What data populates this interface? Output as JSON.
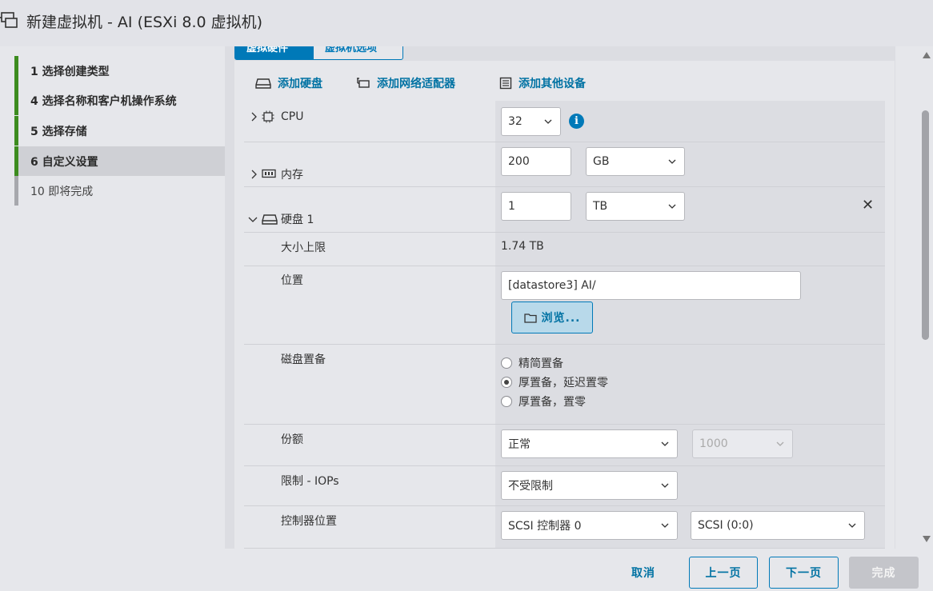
{
  "window": {
    "title": "新建虚拟机 - AI (ESXi 8.0 虚拟机)"
  },
  "steps": [
    {
      "label": "1   选择创建类型",
      "state": "done"
    },
    {
      "label": "4   选择名称和客户机操作系统",
      "state": "done"
    },
    {
      "label": "5   选择存储",
      "state": "done"
    },
    {
      "label": "6   自定义设置",
      "state": "active"
    },
    {
      "label": "10   即将完成",
      "state": "pending"
    }
  ],
  "tabs": {
    "hardware": "虚拟硬件",
    "options": "虚拟机选项"
  },
  "toolbar": {
    "add_disk": "添加硬盘",
    "add_network": "添加网络适配器",
    "add_other": "添加其他设备"
  },
  "cpu": {
    "label": "CPU",
    "value": "32"
  },
  "memory": {
    "label": "内存",
    "value": "200",
    "unit": "GB"
  },
  "disk": {
    "label": "硬盘 1",
    "value": "1",
    "unit": "TB",
    "max_size_label": "大小上限",
    "max_size_value": "1.74 TB",
    "location_label": "位置",
    "location_value": "[datastore3] AI/",
    "browse_label": "浏览...",
    "provisioning_label": "磁盘置备",
    "provisioning_options": [
      "精简置备",
      "厚置备，延迟置零",
      "厚置备，置零"
    ],
    "provisioning_selected": 1,
    "shares_label": "份额",
    "shares_value": "正常",
    "shares_number": "1000",
    "limit_label": "限制 - IOPs",
    "limit_value": "不受限制",
    "controller_label": "控制器位置",
    "controller_value": "SCSI 控制器 0",
    "controller_slot": "SCSI (0:0)"
  },
  "footer": {
    "cancel": "取消",
    "back": "上一页",
    "next": "下一页",
    "finish": "完成"
  },
  "colors": {
    "accent": "#0079b8",
    "step_done": "#3d8c1f",
    "link": "#0072a3"
  }
}
